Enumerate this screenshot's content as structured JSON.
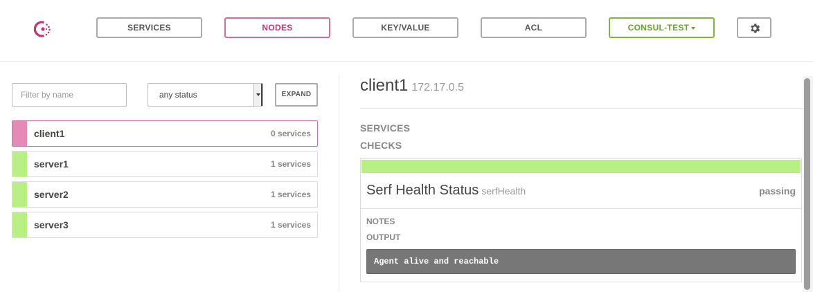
{
  "colors": {
    "accent": "#c0347a",
    "passing": "#b8f083",
    "critical": "#e38bb6",
    "datacenter": "#7fb642"
  },
  "nav": {
    "logo_icon": "consul-logo-icon",
    "items": [
      {
        "label": "SERVICES"
      },
      {
        "label": "NODES",
        "active": true
      },
      {
        "label": "KEY/VALUE"
      },
      {
        "label": "ACL"
      }
    ],
    "datacenter": "CONSUL-TEST",
    "settings_icon": "gear-icon"
  },
  "filters": {
    "name_placeholder": "Filter by name",
    "name_value": "",
    "status_selected": "any status",
    "expand_label": "EXPAND"
  },
  "nodes": [
    {
      "name": "client1",
      "services": "0 services",
      "status": "critical",
      "selected": true
    },
    {
      "name": "server1",
      "services": "1 services",
      "status": "passing"
    },
    {
      "name": "server2",
      "services": "1 services",
      "status": "passing"
    },
    {
      "name": "server3",
      "services": "1 services",
      "status": "passing"
    }
  ],
  "detail": {
    "name": "client1",
    "address": "172.17.0.5",
    "services_heading": "SERVICES",
    "checks_heading": "CHECKS",
    "check": {
      "name": "Serf Health Status",
      "id": "serfHealth",
      "status": "passing",
      "notes_label": "NOTES",
      "output_label": "OUTPUT",
      "output": "Agent alive and reachable"
    }
  }
}
